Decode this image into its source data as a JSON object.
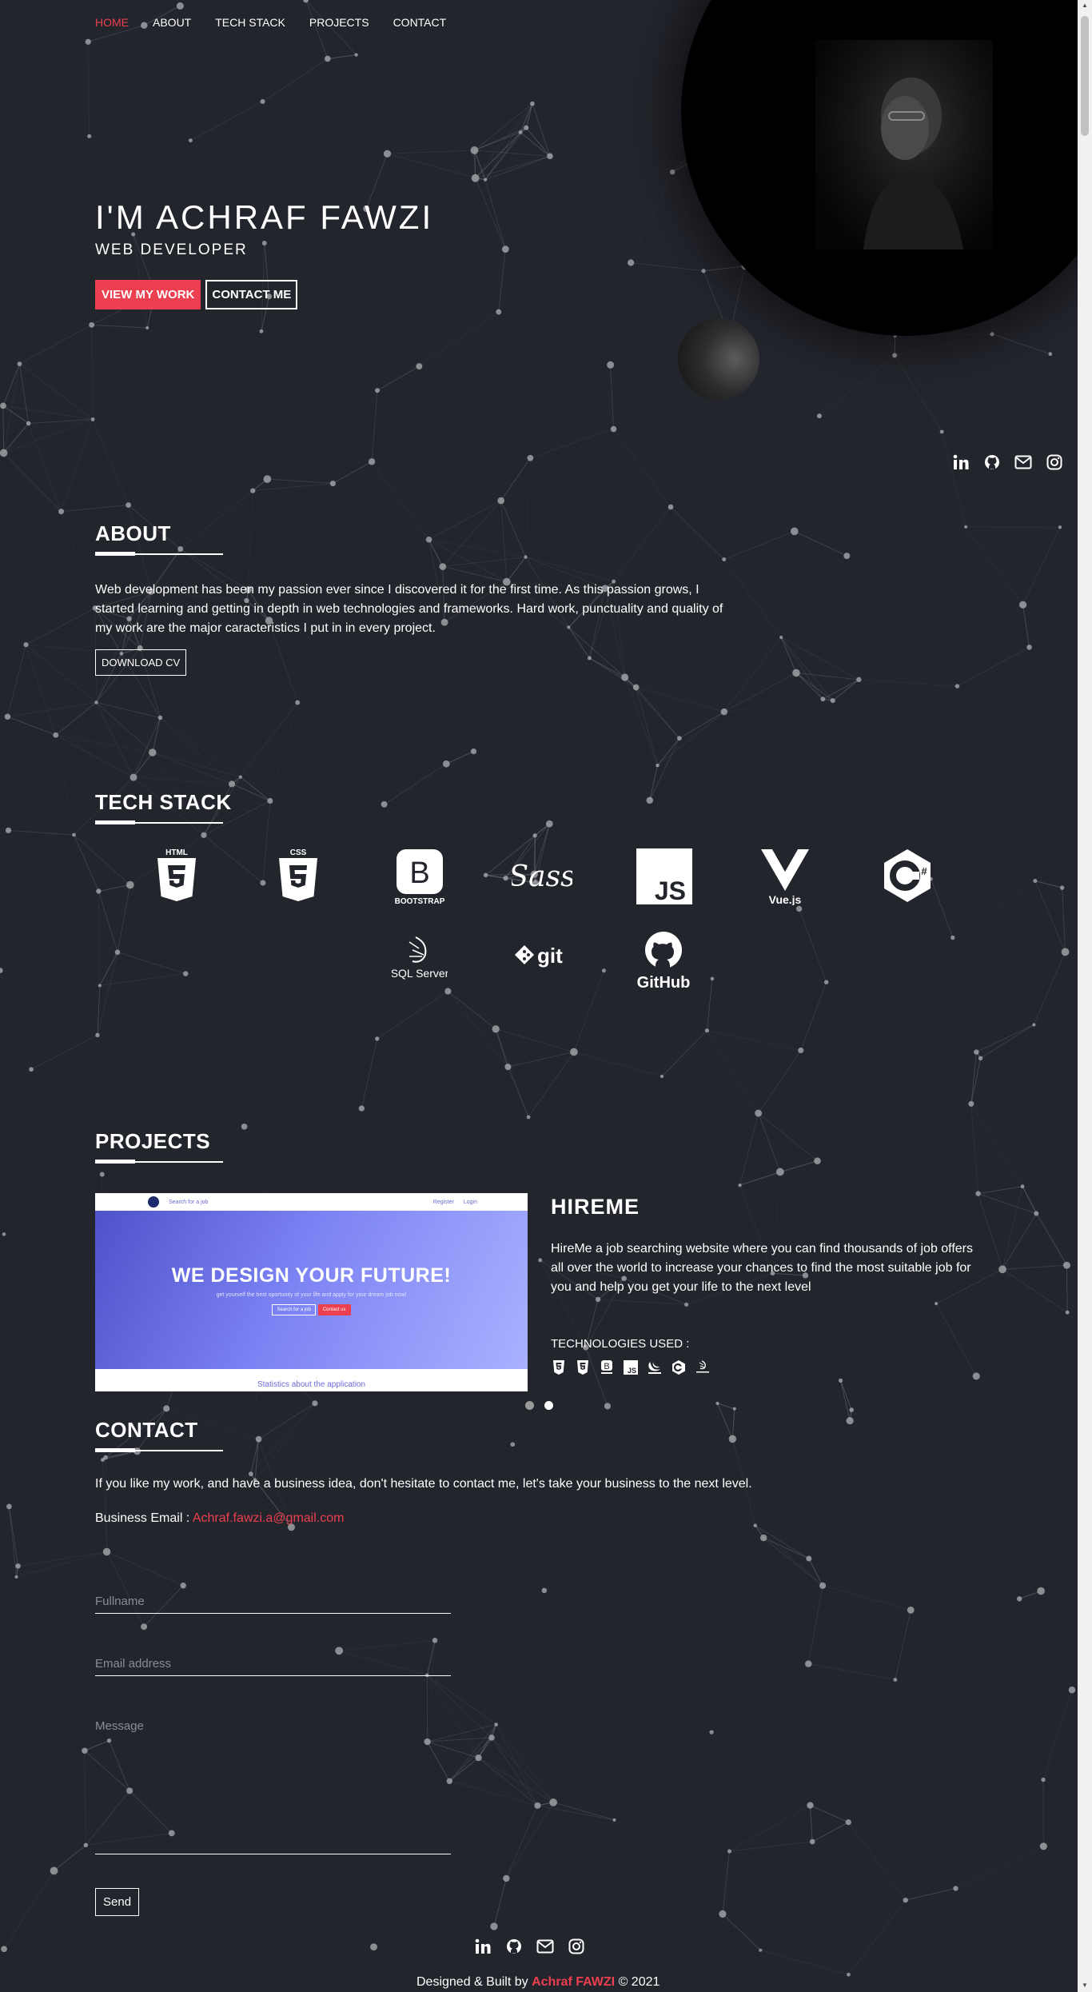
{
  "nav": {
    "items": [
      {
        "label": "HOME",
        "active": true
      },
      {
        "label": "ABOUT",
        "active": false
      },
      {
        "label": "TECH STACK",
        "active": false
      },
      {
        "label": "PROJECTS",
        "active": false
      },
      {
        "label": "CONTACT",
        "active": false
      }
    ]
  },
  "hero": {
    "title": "I'M ACHRAF FAWZI",
    "subtitle": "WEB DEVELOPER",
    "view_work_label": "VIEW MY WORK",
    "contact_label": "CONTACT ME"
  },
  "social": [
    "linkedin-icon",
    "github-icon",
    "mail-icon",
    "instagram-icon"
  ],
  "about": {
    "title": "ABOUT",
    "text": "Web development has been my passion ever since I discovered it for the first time. As this passion grows, I started learning and getting in depth in web technologies and frameworks. Hard work, punctuality and quality of my work are the major caracteristics I put in in every project.",
    "download_label": "DOWNLOAD CV"
  },
  "tech_stack": {
    "title": "TECH STACK",
    "items": [
      {
        "icon": "html5-icon",
        "label": "HTML"
      },
      {
        "icon": "css3-icon",
        "label": "CSS"
      },
      {
        "icon": "bootstrap-icon",
        "label": "BOOTSTRAP"
      },
      {
        "icon": "sass-icon",
        "label": "Sass"
      },
      {
        "icon": "javascript-icon",
        "label": "JS"
      },
      {
        "icon": "vuejs-icon",
        "label": "Vue.js"
      },
      {
        "icon": "csharp-icon",
        "label": "C#"
      },
      {
        "icon": "sql-server-icon",
        "label": "SQL Server"
      },
      {
        "icon": "git-icon",
        "label": "git"
      },
      {
        "icon": "github-icon",
        "label": "GitHub"
      }
    ]
  },
  "projects": {
    "title": "PROJECTS",
    "screenshot": {
      "nav_search": "Search for a job",
      "nav_register": "Register",
      "nav_login": "Login",
      "headline": "WE DESIGN YOUR FUTURE!",
      "subline": "get yourself the best oportunity of your life and apply for your dream job now!",
      "btn_search": "Search for a job",
      "btn_contact": "Contact us",
      "footer": "Statistics about the application"
    },
    "name": "HIREME",
    "description": "HireMe a job searching website where you can find thousands of job offers all over the world to increase your chances to find the most suitable job for you and help you get your life to the next level",
    "tech_label": "TECHNOLOGIES USED :",
    "tech_icons": [
      "html5-icon",
      "css3-icon",
      "bootstrap-icon",
      "javascript-icon",
      "jquery-icon",
      "csharp-icon",
      "sql-server-icon"
    ],
    "carousel_count": 2,
    "carousel_active": 2
  },
  "contact": {
    "title": "CONTACT",
    "text": "If you like my work, and have a business idea, don't hesitate to contact me, let's take your business to the next level.",
    "email_label": "Business Email :",
    "email": "Achraf.fawzi.a@gmail.com",
    "fullname_placeholder": "Fullname",
    "email_placeholder": "Email address",
    "message_placeholder": "Message",
    "send_label": "Send"
  },
  "footer": {
    "prefix": "Designed & Built by",
    "author": "Achraf FAWZI",
    "suffix": "© 2021"
  },
  "colors": {
    "background": "#23252c",
    "accent": "#ec3f4f",
    "text": "#ffffff"
  }
}
